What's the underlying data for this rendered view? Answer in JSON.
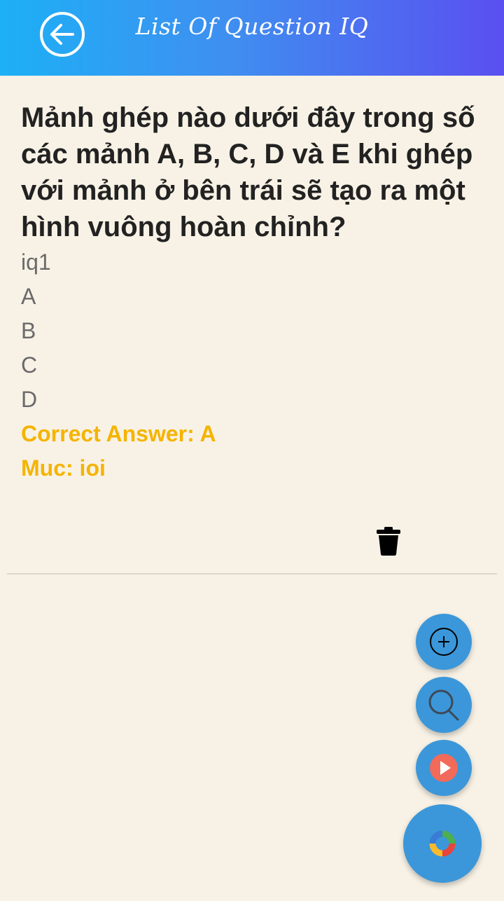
{
  "header": {
    "title": "List Of Question IQ",
    "back_icon": "arrow-left-circle-icon"
  },
  "question": {
    "text": "Mảnh ghép nào dưới đây trong số các mảnh A, B, C, D và E khi ghép với mảnh ở bên trái sẽ tạo ra một hình vuông hoàn chỉnh?",
    "image_ref": "iq1",
    "options": [
      "A",
      "B",
      "C",
      "D"
    ],
    "correct_answer": "Correct Answer: A",
    "category": "Muc: ioi"
  },
  "actions": {
    "delete_icon": "trash-icon",
    "fab_add_icon": "add-circle-icon",
    "fab_search_icon": "search-icon",
    "fab_play_icon": "play-icon",
    "fab_main_icon": "colorful-ring-icon"
  },
  "colors": {
    "accent_text": "#f5b400",
    "fab": "#3b97d9",
    "header_start": "#1db0f6",
    "header_end": "#5a4ff0",
    "background": "#f8f2e6"
  }
}
